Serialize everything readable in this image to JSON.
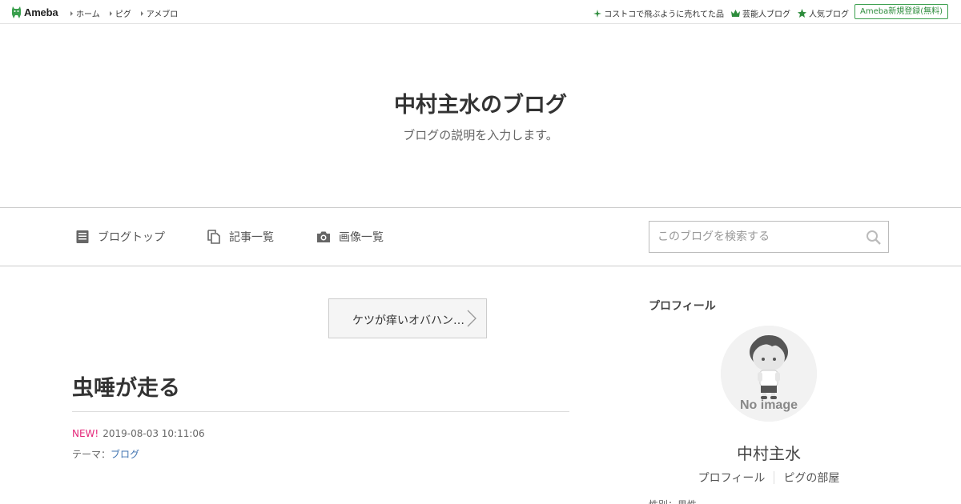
{
  "topbar": {
    "logo_text": "Ameba",
    "nav": [
      {
        "label": "ホーム"
      },
      {
        "label": "ピグ"
      },
      {
        "label": "アメブロ"
      }
    ],
    "links": [
      {
        "label": "コストコで飛ぶように売れてた品",
        "icon": "sparkle-icon"
      },
      {
        "label": "芸能人ブログ",
        "icon": "crown-icon"
      },
      {
        "label": "人気ブログ",
        "icon": "star-icon"
      }
    ],
    "signup_label": "Ameba新規登録(無料)"
  },
  "header": {
    "title": "中村主水のブログ",
    "description": "ブログの説明を入力します。"
  },
  "nav": {
    "items": [
      {
        "label": "ブログトップ",
        "icon": "document-icon"
      },
      {
        "label": "記事一覧",
        "icon": "copy-icon"
      },
      {
        "label": "画像一覧",
        "icon": "camera-icon"
      }
    ],
    "search_placeholder": "このブログを検索する"
  },
  "entry": {
    "prev_label": "ケツが痒いオバハン…",
    "title": "虫唾が走る",
    "new_badge": "NEW!",
    "datetime": "2019-08-03 10:11:06",
    "theme_prefix": "テーマ：",
    "theme": "ブログ"
  },
  "sidebar": {
    "heading": "プロフィール",
    "avatar_label": "No image",
    "name": "中村主水",
    "links": [
      {
        "label": "プロフィール"
      },
      {
        "label": "ピグの部屋"
      }
    ],
    "cut_text": "性別：男性"
  },
  "colors": {
    "accent_green": "#2d8c3c",
    "new_pink": "#e4287a",
    "link_blue": "#3f73b0"
  }
}
